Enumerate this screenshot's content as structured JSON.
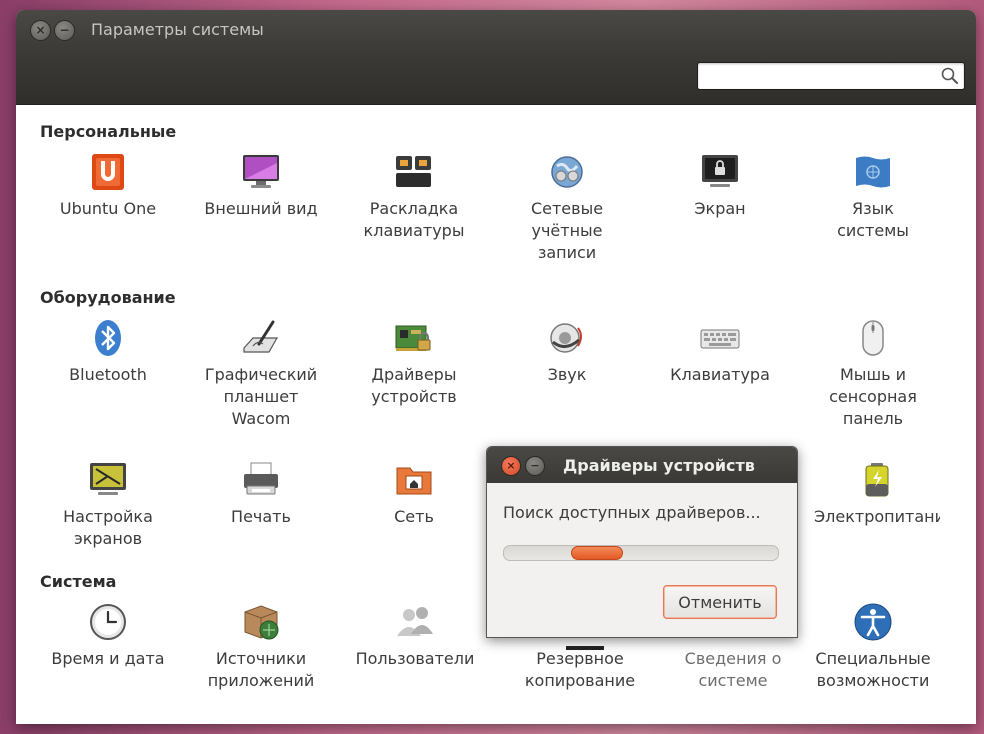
{
  "window": {
    "title": "Параметры системы",
    "search_placeholder": ""
  },
  "sections": [
    {
      "title": "Персональные",
      "items": [
        {
          "label": "Ubuntu One",
          "icon": "ubuntu-one-icon"
        },
        {
          "label": "Внешний вид",
          "icon": "appearance-monitor-icon"
        },
        {
          "label": "Раскладка\nклавиатуры",
          "icon": "keyboard-layout-icon"
        },
        {
          "label": "Сетевые\nучётные\nзаписи",
          "icon": "online-accounts-icon"
        },
        {
          "label": "Экран",
          "icon": "screen-lock-icon"
        },
        {
          "label": "Язык\nсистемы",
          "icon": "language-flag-icon"
        }
      ]
    },
    {
      "title": "Оборудование",
      "items": [
        {
          "label": "Bluetooth",
          "icon": "bluetooth-icon"
        },
        {
          "label": "Графический\nпланшет\nWacom",
          "icon": "wacom-tablet-icon"
        },
        {
          "label": "Драйверы\nустройств",
          "icon": "device-drivers-icon"
        },
        {
          "label": "Звук",
          "icon": "sound-icon"
        },
        {
          "label": "Клавиатура",
          "icon": "keyboard-icon"
        },
        {
          "label": "Мышь и\nсенсорная\nпанель",
          "icon": "mouse-icon"
        },
        {
          "label": "Настройка\nэкранов",
          "icon": "displays-icon"
        },
        {
          "label": "Печать",
          "icon": "printer-icon"
        },
        {
          "label": "Сеть",
          "icon": "network-icon"
        },
        {
          "label": "Электропитание",
          "icon": "power-battery-icon"
        }
      ]
    },
    {
      "title": "Система",
      "items": [
        {
          "label": "Время и дата",
          "icon": "clock-icon"
        },
        {
          "label": "Источники\nприложений",
          "icon": "software-sources-icon"
        },
        {
          "label": "Пользователи",
          "icon": "users-icon"
        },
        {
          "label": "Резервное\nкопирование",
          "icon": "backup-icon"
        },
        {
          "label": "Сведения о\nсистеме",
          "icon": "system-info-icon"
        },
        {
          "label": "Специальные\nвозможности",
          "icon": "accessibility-icon"
        }
      ]
    }
  ],
  "dialog": {
    "title": "Драйверы устройств",
    "message": "Поиск доступных драйверов...",
    "cancel_label": "Отменить",
    "progress_position": 0.3
  }
}
